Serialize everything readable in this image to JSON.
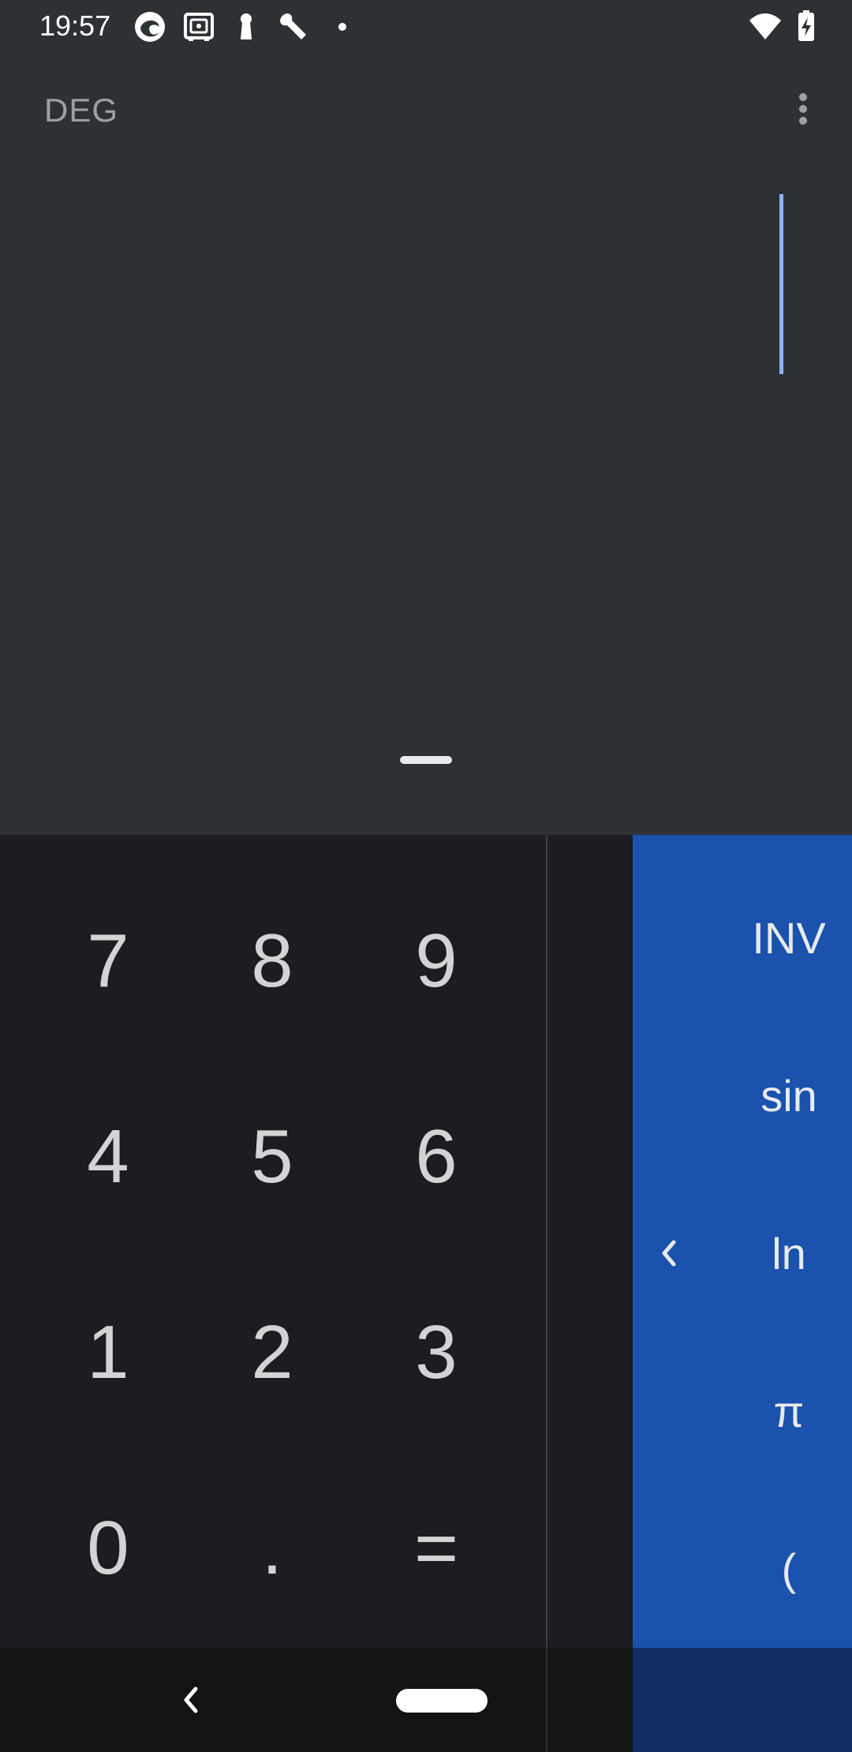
{
  "status_bar": {
    "time": "19:57",
    "left_icons": [
      "edge-browser-icon",
      "safe-icon",
      "keyhole-icon",
      "wrench-icon",
      "dot-icon"
    ],
    "right_icons": [
      "wifi-icon",
      "battery-charging-icon"
    ]
  },
  "display": {
    "mode_label": "DEG",
    "expression": "",
    "menu_icon": "more-vert-icon"
  },
  "keypad": {
    "rows": [
      [
        "7",
        "8",
        "9"
      ],
      [
        "4",
        "5",
        "6"
      ],
      [
        "1",
        "2",
        "3"
      ],
      [
        "0",
        ".",
        "="
      ]
    ]
  },
  "advanced_panel": {
    "keys": [
      "INV",
      "sin",
      "ln",
      "π",
      "("
    ],
    "collapse_icon": "chevron-left-icon"
  },
  "colors": {
    "background": "#2e3134",
    "keypad": "#1c1d20",
    "accent_panel": "#1a52ad",
    "cursor": "#8ab4f8"
  }
}
